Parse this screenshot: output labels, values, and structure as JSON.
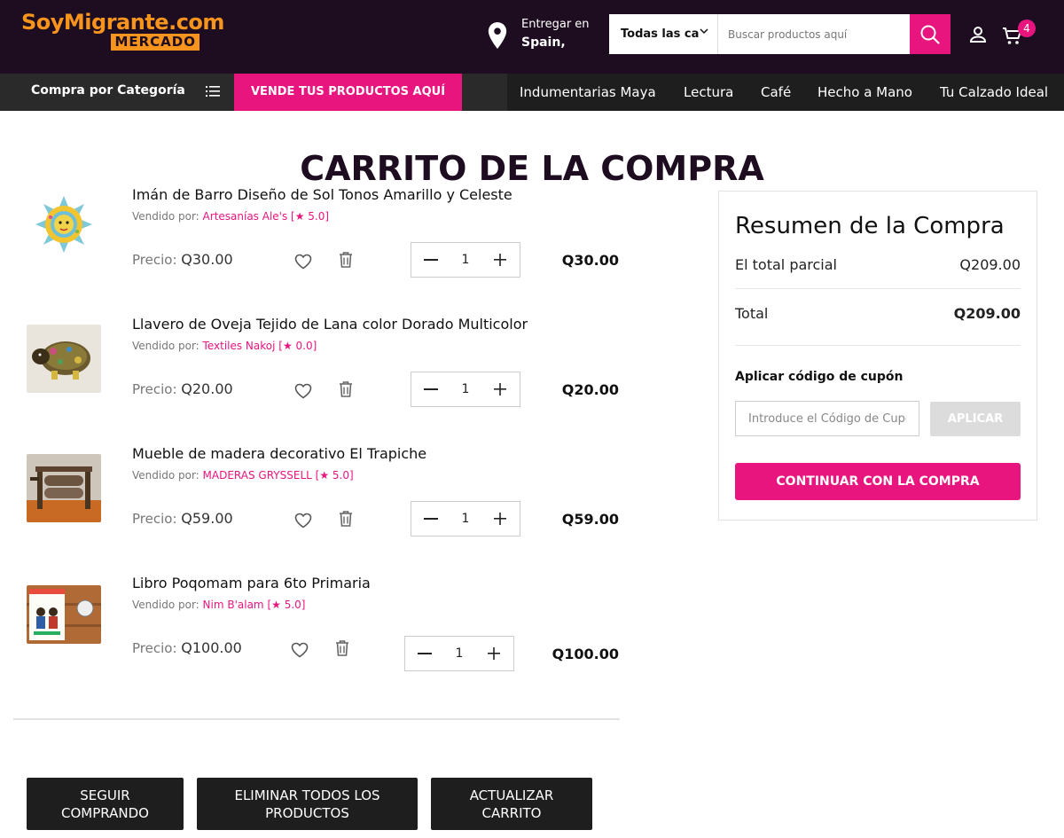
{
  "header": {
    "logo_top": "SoyMigrante.com",
    "logo_bottom": "MERCADO",
    "deliver_label": "Entregar en",
    "deliver_location": "Spain,",
    "search_category": "Todas las ca",
    "search_placeholder": "Buscar productos aquí",
    "cart_count": "4",
    "icons": [
      "location-pin-icon",
      "chevron-down-icon",
      "search-icon",
      "user-icon",
      "cart-icon"
    ]
  },
  "nav": {
    "category_label": "Compra por Categoría",
    "sell_button": "VENDE TUS PRODUCTOS AQUÍ",
    "links": [
      "Indumentarias Maya",
      "Lectura",
      "Café",
      "Hecho a Mano",
      "Tu Calzado Ideal"
    ]
  },
  "page_title": "CARRITO DE LA COMPRA",
  "cart": {
    "items": [
      {
        "name": "Imán de Barro Diseño de Sol Tonos Amarillo y Celeste",
        "sold_by_label": "Vendido por:",
        "seller": "Artesanías Ale's",
        "rating": "[★ 5.0]",
        "price_label": "Precio:",
        "price": "Q30.00",
        "quantity": "1",
        "total": "Q30.00"
      },
      {
        "name": "Llavero de Oveja Tejido de Lana color Dorado Multicolor",
        "sold_by_label": "Vendido por:",
        "seller": "Textiles Nakoj",
        "rating": "[★ 0.0]",
        "price_label": "Precio:",
        "price": "Q20.00",
        "quantity": "1",
        "total": "Q20.00"
      },
      {
        "name": "Mueble de madera decorativo El Trapiche",
        "sold_by_label": "Vendido por:",
        "seller": "MADERAS GRYSSELL",
        "rating": "[★ 5.0]",
        "price_label": "Precio:",
        "price": "Q59.00",
        "quantity": "1",
        "total": "Q59.00"
      },
      {
        "name": "Libro Poqomam para 6to Primaria",
        "sold_by_label": "Vendido por:",
        "seller": "Nim B'alam",
        "rating": "[★ 5.0]",
        "price_label": "Precio:",
        "price": "Q100.00",
        "quantity": "1",
        "total": "Q100.00"
      }
    ],
    "buttons": {
      "continue_shopping": "SEGUIR COMPRANDO",
      "remove_all": "ELIMINAR TODOS LOS PRODUCTOS",
      "update_cart": "ACTUALIZAR CARRITO"
    }
  },
  "summary": {
    "title": "Resumen de la Compra",
    "subtotal_label": "El total parcial",
    "subtotal_value": "Q209.00",
    "total_label": "Total",
    "total_value": "Q209.00",
    "coupon_label": "Aplicar código de cupón",
    "coupon_placeholder": "Introduce el Código de Cupón",
    "apply_button": "APLICAR",
    "checkout_button": "CONTINUAR CON LA COMPRA"
  },
  "colors": {
    "brand_dark": "#1e0d20",
    "accent": "#e8157f",
    "logo_orange": "#f7941d"
  }
}
